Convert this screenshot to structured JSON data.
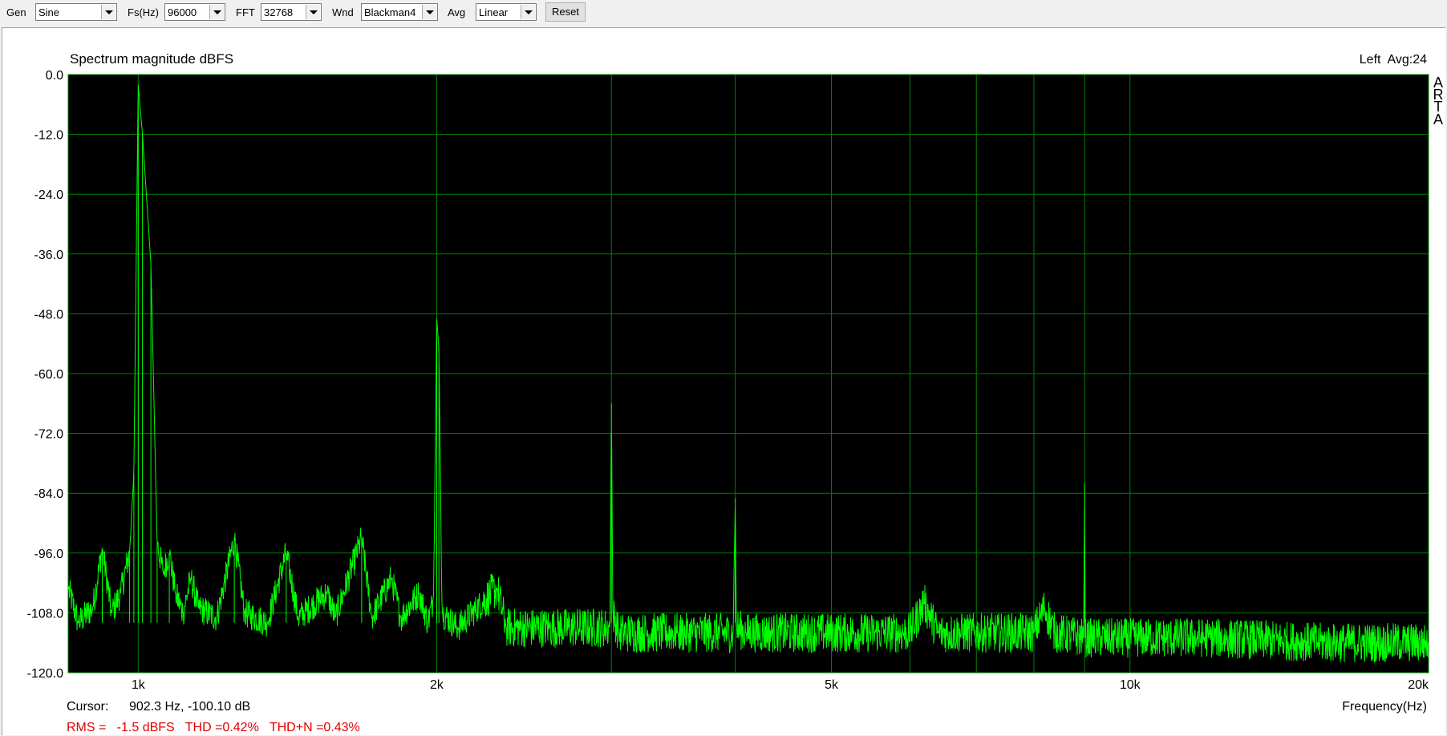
{
  "toolbar": {
    "gen_label": "Gen",
    "gen_value": "Sine",
    "fs_label": "Fs(Hz)",
    "fs_value": "96000",
    "fft_label": "FFT",
    "fft_value": "32768",
    "wnd_label": "Wnd",
    "wnd_value": "Blackman4",
    "avg_label": "Avg",
    "avg_value": "Linear",
    "reset_label": "Reset"
  },
  "header": {
    "channel_info": "Left  Avg:24",
    "brand": [
      "A",
      "R",
      "T",
      "A"
    ]
  },
  "footer": {
    "cursor_label": "Cursor:",
    "cursor_value": "902.3 Hz, -100.10 dB",
    "measurements": "RMS =   -1.5 dBFS   THD =0.42%   THD+N =0.43%"
  },
  "colors": {
    "plot_bg": "#000000",
    "grid": "#008000",
    "trace": "#00ff00",
    "measure_text": "#e00000"
  },
  "chart_data": {
    "type": "line",
    "title": "Spectrum magnitude dBFS",
    "xlabel": "Frequency(Hz)",
    "ylabel": "",
    "x_scale": "log",
    "xlim": [
      850,
      20000
    ],
    "ylim": [
      -120,
      0
    ],
    "grid": true,
    "xticks": [
      {
        "value": 1000,
        "label": "1k"
      },
      {
        "value": 2000,
        "label": "2k"
      },
      {
        "value": 5000,
        "label": "5k"
      },
      {
        "value": 10000,
        "label": "10k"
      },
      {
        "value": 20000,
        "label": "20k"
      }
    ],
    "xgrid": [
      1000,
      2000,
      3000,
      4000,
      5000,
      6000,
      7000,
      8000,
      9000,
      10000,
      20000
    ],
    "yticks": [
      {
        "value": 0,
        "label": "0.0"
      },
      {
        "value": -12,
        "label": "-12.0"
      },
      {
        "value": -24,
        "label": "-24.0"
      },
      {
        "value": -36,
        "label": "-36.0"
      },
      {
        "value": -48,
        "label": "-48.0"
      },
      {
        "value": -60,
        "label": "-60.0"
      },
      {
        "value": -72,
        "label": "-72.0"
      },
      {
        "value": -84,
        "label": "-84.0"
      },
      {
        "value": -96,
        "label": "-96.0"
      },
      {
        "value": -108,
        "label": "-108.0"
      },
      {
        "value": -120,
        "label": "-120.0"
      }
    ],
    "noise_floor_db": -111,
    "series": [
      {
        "points": [
          [
            850,
            -103
          ],
          [
            870,
            -110
          ],
          [
            900,
            -107
          ],
          [
            920,
            -95
          ],
          [
            940,
            -108
          ],
          [
            960,
            -104
          ],
          [
            980,
            -96
          ],
          [
            990,
            -80
          ],
          [
            1000,
            -2
          ],
          [
            1010,
            -12
          ],
          [
            1030,
            -38
          ],
          [
            1045,
            -94
          ],
          [
            1060,
            -100
          ],
          [
            1075,
            -96
          ],
          [
            1090,
            -104
          ],
          [
            1110,
            -108
          ],
          [
            1130,
            -101
          ],
          [
            1150,
            -107
          ],
          [
            1200,
            -109
          ],
          [
            1250,
            -93
          ],
          [
            1280,
            -108
          ],
          [
            1350,
            -110
          ],
          [
            1410,
            -96
          ],
          [
            1450,
            -109
          ],
          [
            1550,
            -104
          ],
          [
            1580,
            -109
          ],
          [
            1680,
            -93
          ],
          [
            1720,
            -109
          ],
          [
            1800,
            -101
          ],
          [
            1840,
            -109
          ],
          [
            1920,
            -104
          ],
          [
            1960,
            -110
          ],
          [
            1985,
            -105
          ],
          [
            2000,
            -49
          ],
          [
            2010,
            -55
          ],
          [
            2025,
            -108
          ],
          [
            2100,
            -111
          ],
          [
            2300,
            -103
          ],
          [
            2350,
            -111
          ],
          [
            2600,
            -111
          ],
          [
            2990,
            -111
          ],
          [
            3000,
            -66
          ],
          [
            3010,
            -108
          ],
          [
            3050,
            -112
          ],
          [
            3500,
            -112
          ],
          [
            3980,
            -112
          ],
          [
            4000,
            -85
          ],
          [
            4010,
            -111
          ],
          [
            4100,
            -112
          ],
          [
            6000,
            -112
          ],
          [
            6200,
            -106
          ],
          [
            6400,
            -112
          ],
          [
            8000,
            -112
          ],
          [
            8200,
            -107
          ],
          [
            8400,
            -112
          ],
          [
            8980,
            -113
          ],
          [
            9000,
            -82
          ],
          [
            9010,
            -113
          ],
          [
            12000,
            -113
          ],
          [
            16000,
            -114
          ],
          [
            20000,
            -114
          ]
        ]
      }
    ]
  }
}
